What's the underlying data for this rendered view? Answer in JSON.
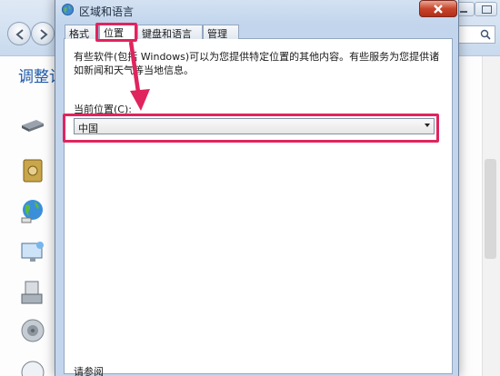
{
  "background_window": {
    "heading_fragment": "调整计"
  },
  "dialog": {
    "title": "区域和语言",
    "tabs": [
      {
        "label": "格式"
      },
      {
        "label": "位置"
      },
      {
        "label": "键盘和语言"
      },
      {
        "label": "管理"
      }
    ],
    "description": "有些软件(包括 Windows)可以为您提供特定位置的其他内容。有些服务为您提供诸如新闻和天气等当地信息。",
    "current_location_label": "当前位置(C):",
    "current_location_value": "中国",
    "see_also_label": "请参阅"
  },
  "annotations": {
    "highlight_color": "#e0245e"
  },
  "icons": [
    "back-arrow-icon",
    "forward-arrow-icon",
    "search-icon",
    "minimize-icon",
    "maximize-icon",
    "globe-icon",
    "close-icon",
    "dropdown-arrow-icon"
  ]
}
